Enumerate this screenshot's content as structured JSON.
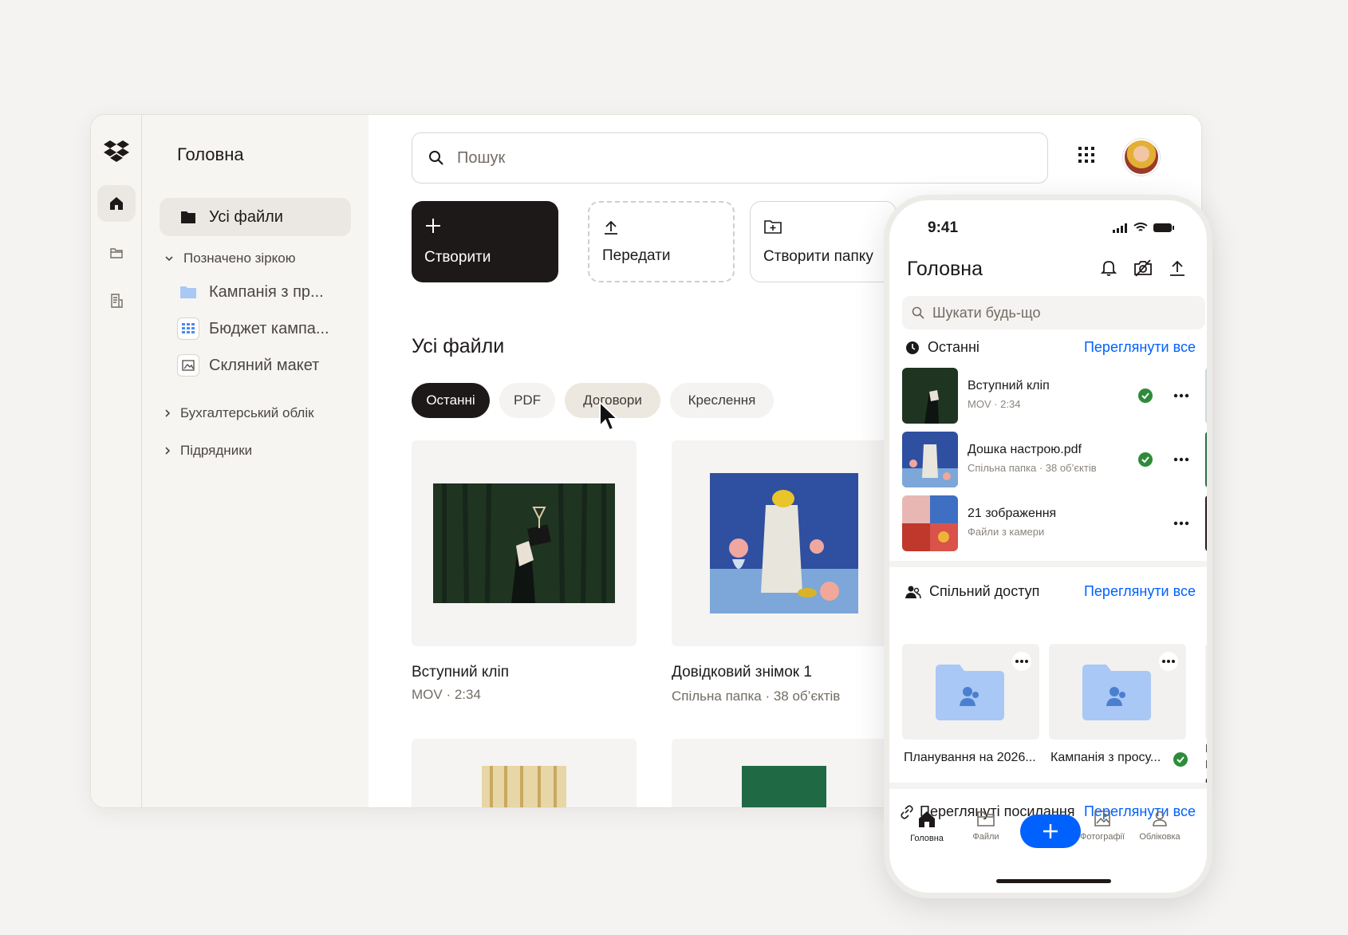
{
  "desktop": {
    "nav_title": "Головна",
    "nav_all_files": "Усі файли",
    "starred_section": "Позначено зіркою",
    "starred_items": [
      "Кампанія з пр...",
      "Бюджет кампа...",
      "Скляний макет"
    ],
    "section_accounting": "Бухгалтерський облік",
    "section_contractors": "Підрядники",
    "search_placeholder": "Пошук",
    "actions": {
      "create": "Створити",
      "upload": "Передати",
      "new_folder": "Створити папку"
    },
    "files_title": "Усі файли",
    "chips": [
      "Останні",
      "PDF",
      "Договори",
      "Креслення"
    ],
    "cards": [
      {
        "title": "Вступний кліп",
        "meta": "MOV · 2:34"
      },
      {
        "title": "Довідковий знімок 1",
        "meta": "Спільна папка ·  38 об’єктів"
      }
    ]
  },
  "phone": {
    "time": "9:41",
    "title": "Головна",
    "search_placeholder": "Шукати будь-що",
    "recents_title": "Останні",
    "view_all": "Переглянути все",
    "recents": [
      {
        "name": "Вступний кліп",
        "meta": "MOV · 2:34"
      },
      {
        "name": "Дошка настрою.pdf",
        "meta": "Спільна папка ·  38 об’єктів"
      },
      {
        "name": "21 зображення",
        "meta": "Файли з камери"
      }
    ],
    "shared_title": "Спільний доступ",
    "shared": [
      {
        "name": "Планування на 2026..."
      },
      {
        "name": "Кампанія з просу..."
      }
    ],
    "shared_peek": "Кі Ре",
    "links_title": "Переглянуті посилання",
    "tabs": [
      "Головна",
      "Файли",
      "Фотографії",
      "Обліковка"
    ]
  },
  "colors": {
    "accent": "#0061fe",
    "dark": "#1e1919",
    "success": "#2e8b3a",
    "folder": "#a9c8f5"
  }
}
